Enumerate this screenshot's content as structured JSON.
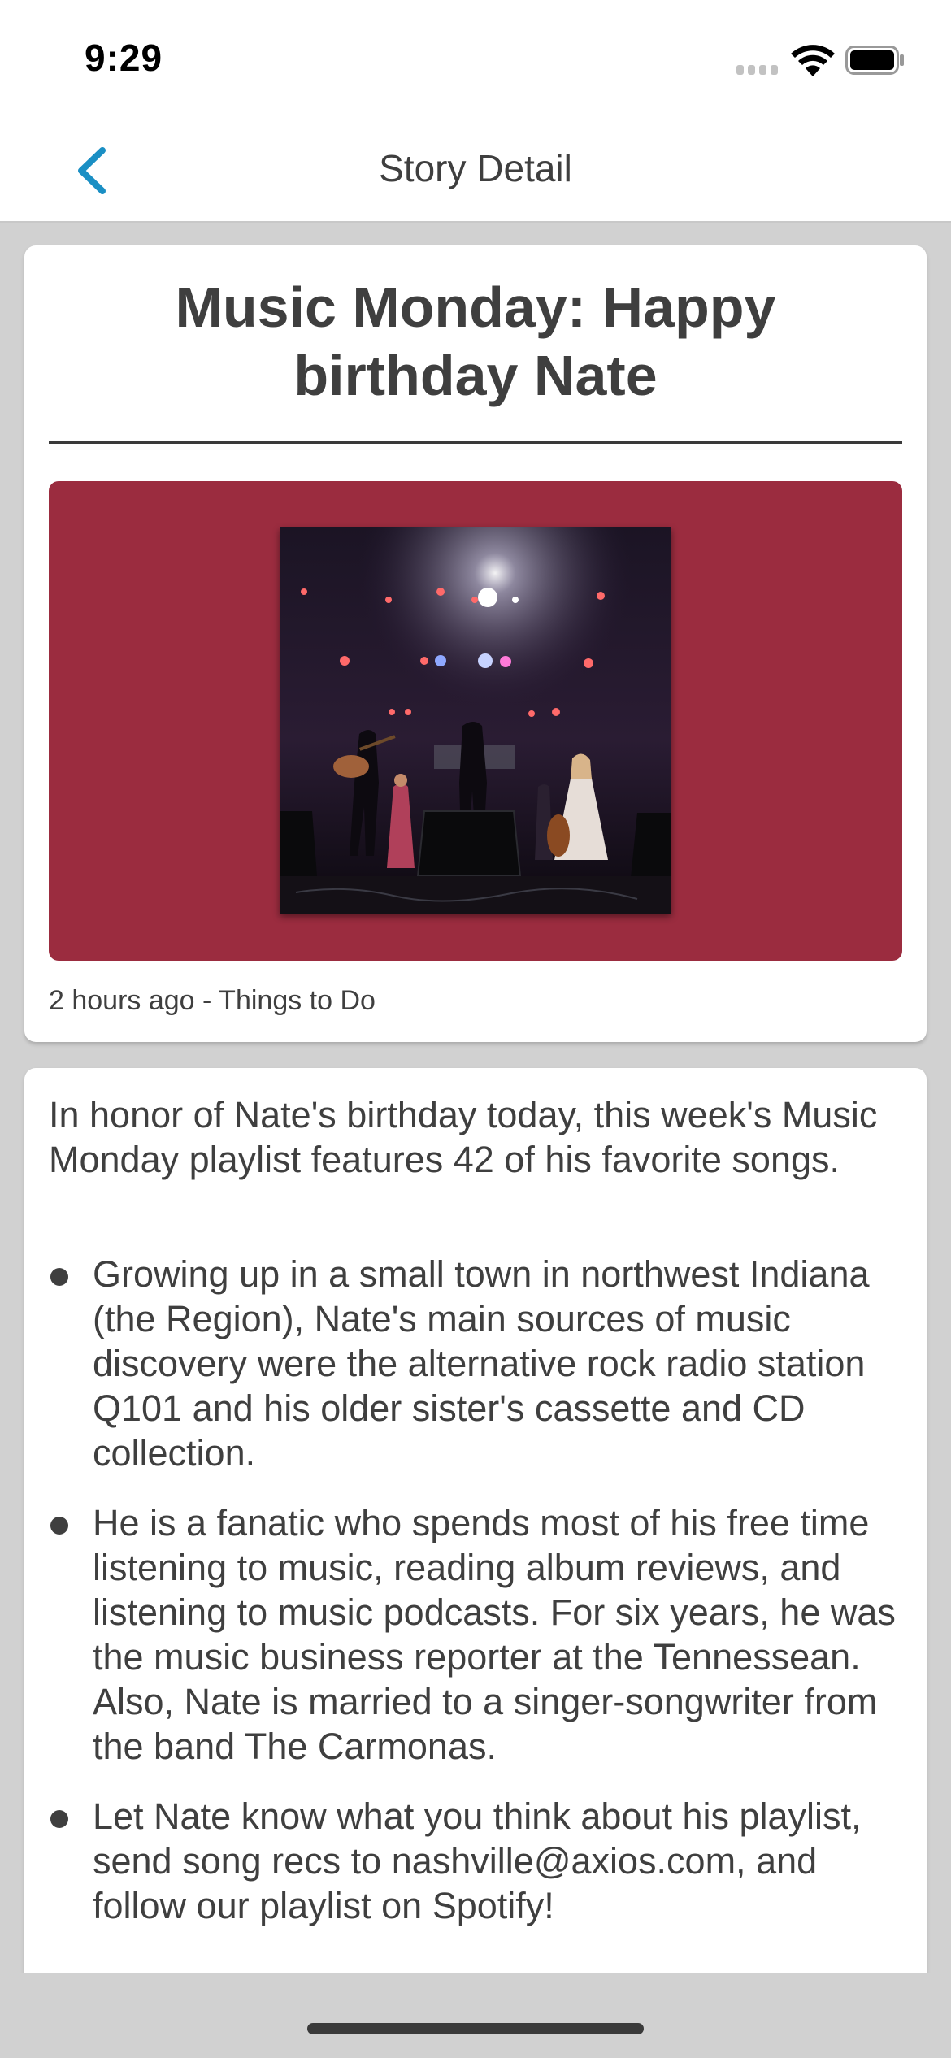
{
  "status_bar": {
    "time": "9:29"
  },
  "nav": {
    "title": "Story Detail",
    "back_icon": "chevron-left-icon",
    "accent_color": "#1a8fc4"
  },
  "story": {
    "title": "Music Monday: Happy birthday Nate",
    "image_background": "#9b2c3f",
    "meta": "2 hours ago - Things to Do"
  },
  "body": {
    "intro": "In honor of Nate's birthday today, this week's Music Monday playlist features 42 of his favorite songs.",
    "bullets": [
      "Growing up in a small town in northwest Indiana (the Region), Nate's main sources of music discovery were the alternative rock radio station Q101 and his older sister's cassette and CD collection.",
      "He is a fanatic who spends most of his free time listening to music, reading album reviews, and listening to music podcasts. For six years, he was the music business reporter at the Tennessean. Also, Nate is married to a singer-songwriter from the band The Carmonas.",
      "Let Nate know what you think about his playlist, send song recs to nashville@axios.com, and follow our playlist on Spotify!"
    ]
  }
}
